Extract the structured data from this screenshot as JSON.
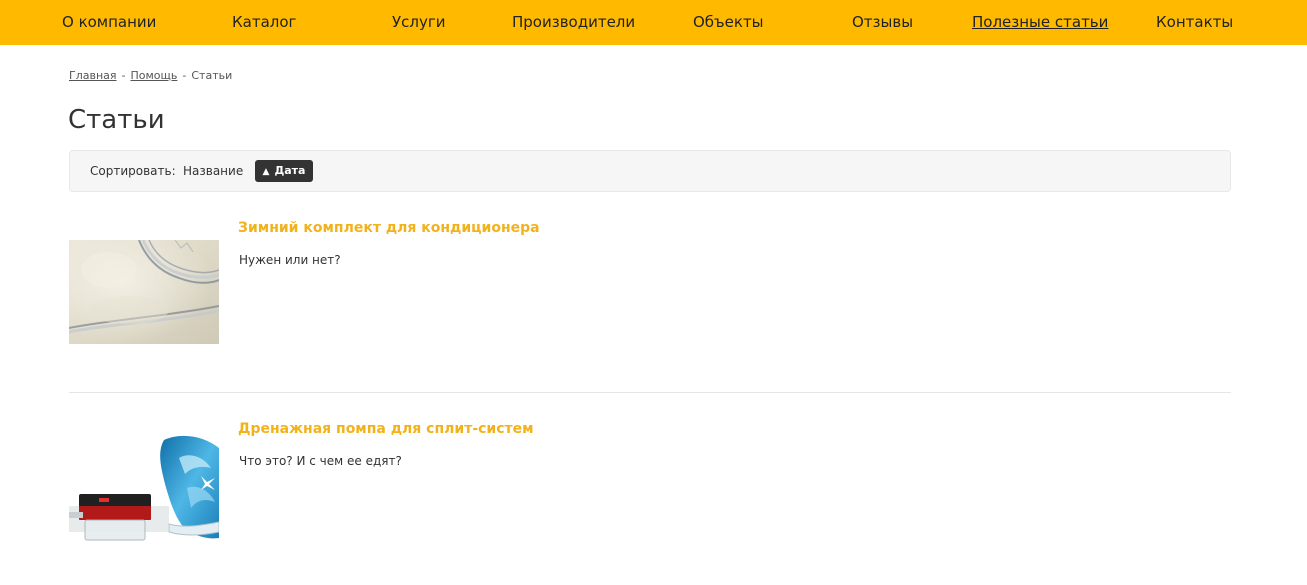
{
  "nav": {
    "items": [
      {
        "label": "О компании"
      },
      {
        "label": "Каталог"
      },
      {
        "label": "Услуги"
      },
      {
        "label": "Производители"
      },
      {
        "label": "Объекты"
      },
      {
        "label": "Отзывы"
      },
      {
        "label": "Полезные статьи",
        "active": true
      },
      {
        "label": "Контакты"
      }
    ]
  },
  "breadcrumb": {
    "items": [
      "Главная",
      "Помощь",
      "Статьи"
    ],
    "separator": "-"
  },
  "page": {
    "title": "Статьи"
  },
  "sort": {
    "label": "Сортировать:",
    "options": [
      "Название",
      "Дата"
    ],
    "active": "Дата",
    "active_direction_icon": "triangle-up-icon"
  },
  "articles": [
    {
      "title": "Зимний комплект для кондиционера",
      "description": "Нужен или нет?",
      "thumbnail": "frosted-fan-image"
    },
    {
      "title": "Дренажная помпа для сплит-систем",
      "description": "Что это? И с чем ее едят?",
      "thumbnail": "drain-pump-water-image"
    }
  ],
  "colors": {
    "nav_background": "#ffba00",
    "article_title": "#f2b21b",
    "sort_active_background": "#333333",
    "sortbar_background": "#f6f6f6"
  }
}
